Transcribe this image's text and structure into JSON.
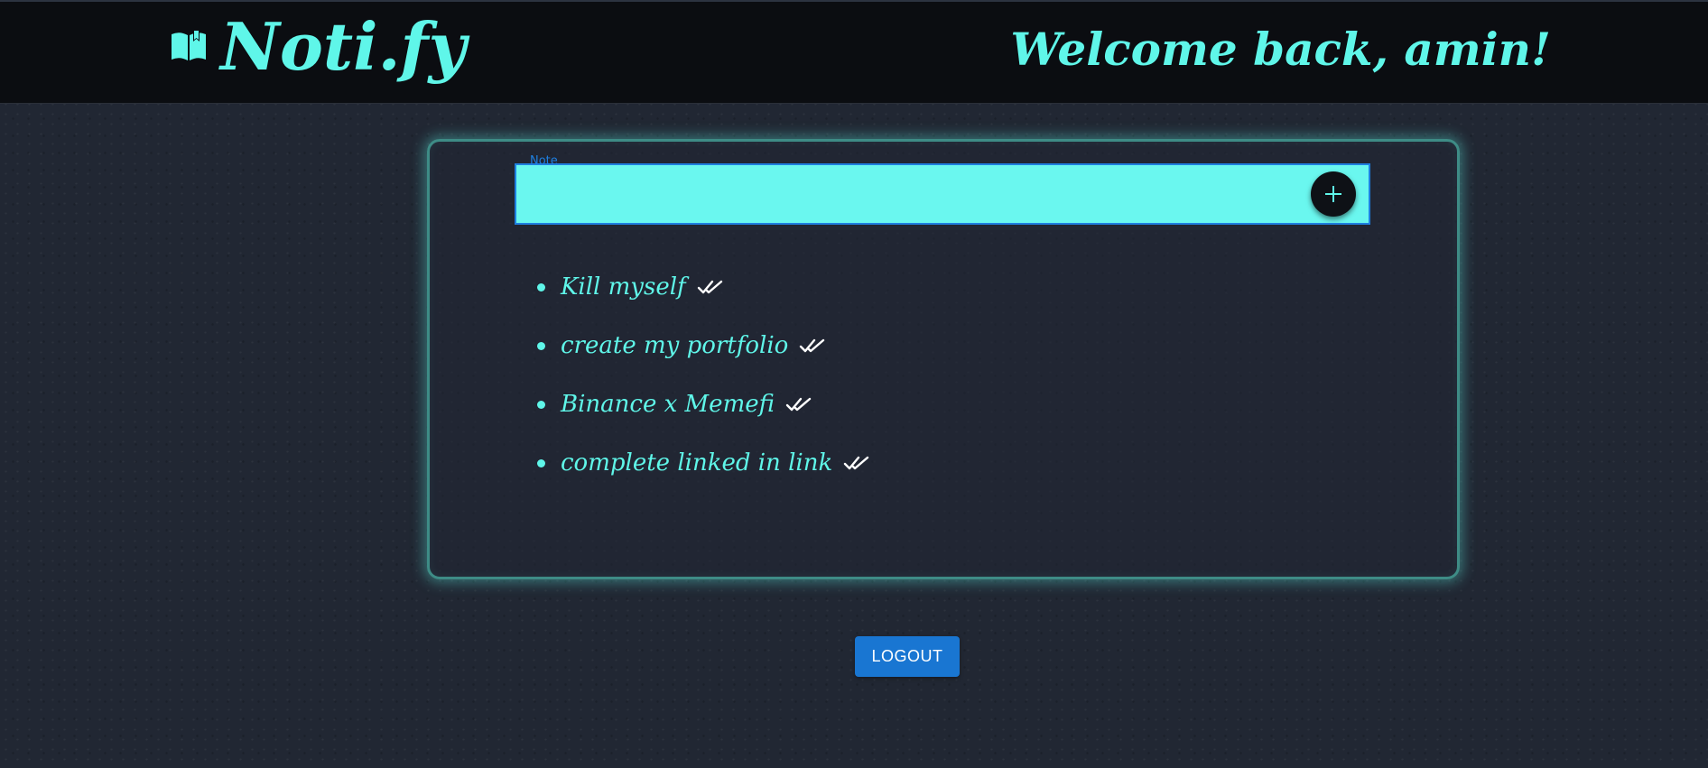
{
  "header": {
    "brand": "Noti.fy",
    "welcome": "Welcome back, amin!"
  },
  "note_form": {
    "label": "Note",
    "value": "",
    "add_icon": "plus-icon"
  },
  "todos": [
    {
      "text": "Kill myself",
      "icon": "double-check-icon"
    },
    {
      "text": "create my portfolio",
      "icon": "double-check-icon"
    },
    {
      "text": "Binance x Memefi",
      "icon": "double-check-icon"
    },
    {
      "text": "complete linked in link",
      "icon": "double-check-icon"
    }
  ],
  "logout_label": "LOGOUT",
  "colors": {
    "accent": "#5ff6e9",
    "header_bg": "#0b0d11",
    "page_bg": "#212733",
    "input_bg": "#6af7ef",
    "input_border": "#1e7fe0",
    "button_bg": "#1976d2"
  }
}
